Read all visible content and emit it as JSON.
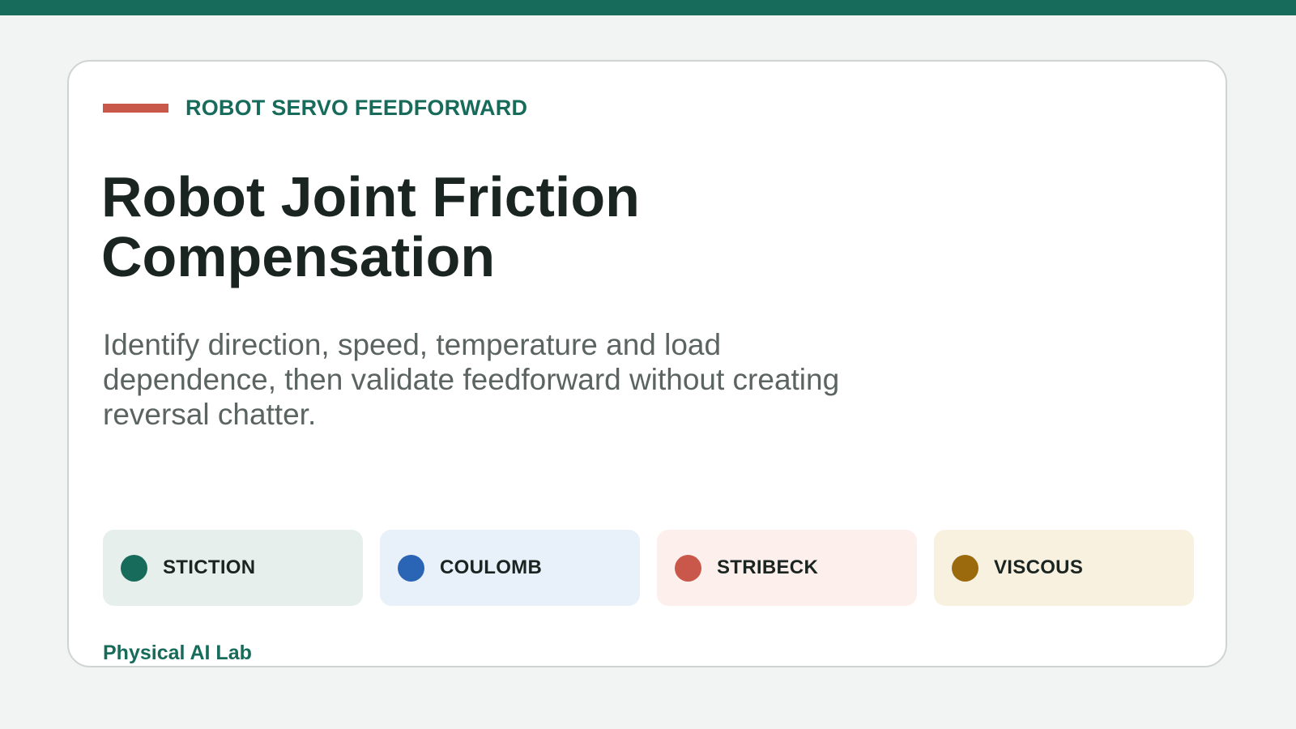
{
  "eyebrow": "ROBOT SERVO FEEDFORWARD",
  "title": "Robot Joint Friction Compensation",
  "subtitle": "Identify direction, speed, temperature and load dependence, then validate feedforward without creating reversal chatter.",
  "chips": [
    {
      "label": "STICTION",
      "dot_color": "#176b5a",
      "bg_color": "#e6efec"
    },
    {
      "label": "COULOMB",
      "dot_color": "#2a64b5",
      "bg_color": "#e8f0fa"
    },
    {
      "label": "STRIBECK",
      "dot_color": "#c9574a",
      "bg_color": "#fdefec"
    },
    {
      "label": "VISCOUS",
      "dot_color": "#9a6a0c",
      "bg_color": "#f9f1e0"
    }
  ],
  "footer": "Physical AI Lab",
  "colors": {
    "accent": "#176b5a",
    "eyebrow_rule": "#c9574a",
    "background": "#f2f4f3",
    "card": "#ffffff"
  }
}
